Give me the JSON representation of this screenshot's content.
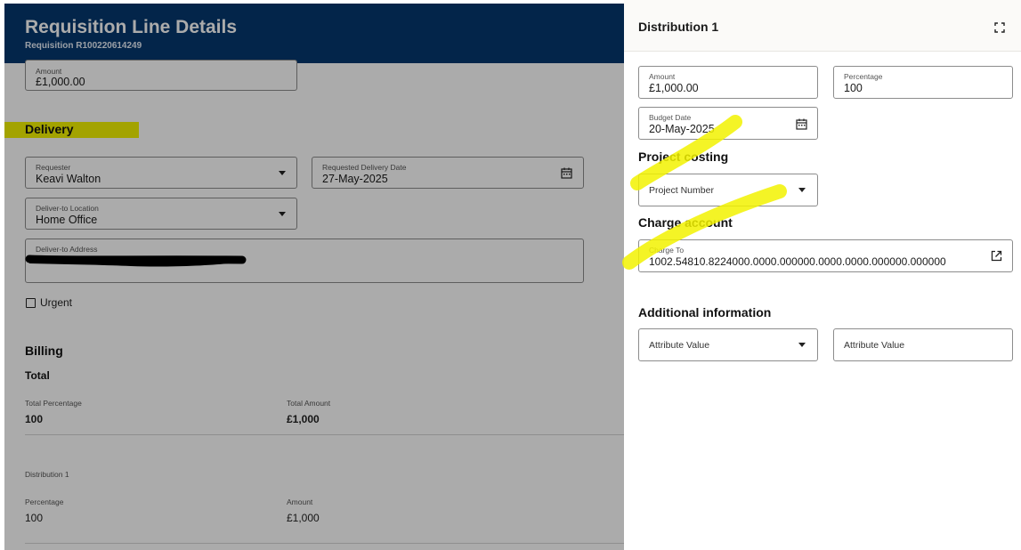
{
  "header": {
    "title": "Requisition Line Details",
    "subtitle": "Requisition R100220614249"
  },
  "line_amount": {
    "label": "Amount",
    "value": "£1,000.00"
  },
  "delivery": {
    "title": "Delivery",
    "requester": {
      "label": "Requester",
      "value": "Keavi Walton"
    },
    "requested_date": {
      "label": "Requested Delivery Date",
      "value": "27-May-2025"
    },
    "deliver_to_location": {
      "label": "Deliver-to Location",
      "value": "Home Office"
    },
    "deliver_to_address": {
      "label": "Deliver-to Address"
    },
    "urgent_label": "Urgent"
  },
  "billing": {
    "title": "Billing",
    "total_title": "Total",
    "total_percentage": {
      "label": "Total Percentage",
      "value": "100"
    },
    "total_amount": {
      "label": "Total Amount",
      "value": "£1,000"
    },
    "distribution_label": "Distribution 1",
    "percentage": {
      "label": "Percentage",
      "value": "100"
    },
    "amount": {
      "label": "Amount",
      "value": "£1,000"
    }
  },
  "drawer": {
    "title": "Distribution 1",
    "amount": {
      "label": "Amount",
      "value": "£1,000.00"
    },
    "percentage": {
      "label": "Percentage",
      "value": "100"
    },
    "budget_date": {
      "label": "Budget Date",
      "value": "20-May-2025"
    },
    "project_costing_title": "Project costing",
    "project_number_placeholder": "Project Number",
    "charge_account_title": "Charge account",
    "charge_to": {
      "label": "Charge To",
      "value": "1002.54810.8224000.0000.000000.0000.0000.000000.000000"
    },
    "additional_info_title": "Additional information",
    "attribute_value_1": "Attribute Value",
    "attribute_value_2": "Attribute Value"
  },
  "colors": {
    "header_bg": "#05386f",
    "highlight": "#f4f400",
    "overlay": "rgba(0,0,0,0.33)"
  },
  "icons": [
    "calendar-icon",
    "chevron-down-icon",
    "expand-icon",
    "external-link-icon",
    "checkbox"
  ]
}
